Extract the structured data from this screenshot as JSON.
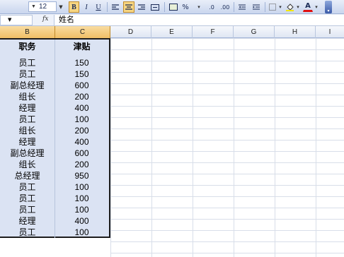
{
  "toolbar": {
    "font_size": "12",
    "bold_label": "B",
    "italic_label": "I",
    "underline_label": "U",
    "percent_label": "%",
    "font_color_label": "A"
  },
  "formula_bar": {
    "fx_label": "fx",
    "content": "姓名"
  },
  "columns": [
    "B",
    "C",
    "D",
    "E",
    "F",
    "G",
    "H",
    "I"
  ],
  "table": {
    "headers": [
      "职务",
      "津贴"
    ],
    "rows": [
      [
        "员工",
        "150"
      ],
      [
        "员工",
        "150"
      ],
      [
        "副总经理",
        "600"
      ],
      [
        "组长",
        "200"
      ],
      [
        "经理",
        "400"
      ],
      [
        "员工",
        "100"
      ],
      [
        "组长",
        "200"
      ],
      [
        "经理",
        "400"
      ],
      [
        "副总经理",
        "600"
      ],
      [
        "组长",
        "200"
      ],
      [
        "总经理",
        "950"
      ],
      [
        "员工",
        "100"
      ],
      [
        "员工",
        "100"
      ],
      [
        "员工",
        "100"
      ],
      [
        "经理",
        "400"
      ],
      [
        "员工",
        "100"
      ]
    ]
  }
}
